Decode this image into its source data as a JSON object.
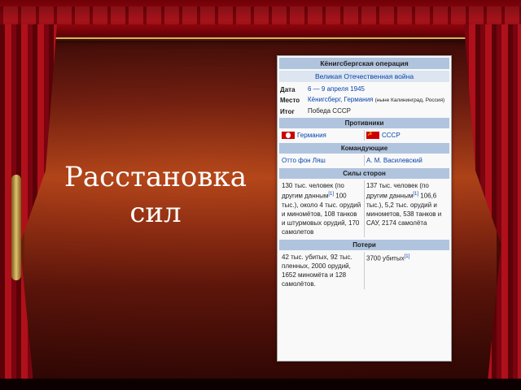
{
  "slide_title": "Расстановка сил",
  "infobox": {
    "title": "Кёнигсбергская операция",
    "subtitle": "Великая Отечественная война",
    "date_label": "Дата",
    "date_value": "6 — 9 апреля 1945",
    "place_label": "Место",
    "place_value": "Кёнигсберг, Германия",
    "place_note": "(ныне Калининград, Россия)",
    "result_label": "Итог",
    "result_value": "Победа СССР",
    "sides_header": "Противники",
    "side_left": "Германия",
    "side_right": "СССР",
    "commanders_header": "Командующие",
    "commander_left": "Отто фон Ляш",
    "commander_right": "А. М. Василевский",
    "forces_header": "Силы сторон",
    "forces_left": "130 тыс. человек (по другим данным",
    "forces_left_ref": "[1]",
    "forces_left_rest": " 100 тыс.), около 4 тыс. орудий и миномётов, 108 танков и штурмовых орудий, 170 самолетов",
    "forces_right": "137 тыс. человек (по другим данным",
    "forces_right_ref": "[1]",
    "forces_right_rest": " 106,6 тыс.), 5,2 тыс. орудий и минометов, 538 танков и САУ, 2174 самолёта",
    "losses_header": "Потери",
    "losses_left": "42 тыс. убитых, 92 тыс. пленных, 2000 орудий, 1652 миномёта и 128 самолётов.",
    "losses_right": "3700 убитых",
    "losses_right_ref": "[1]"
  }
}
